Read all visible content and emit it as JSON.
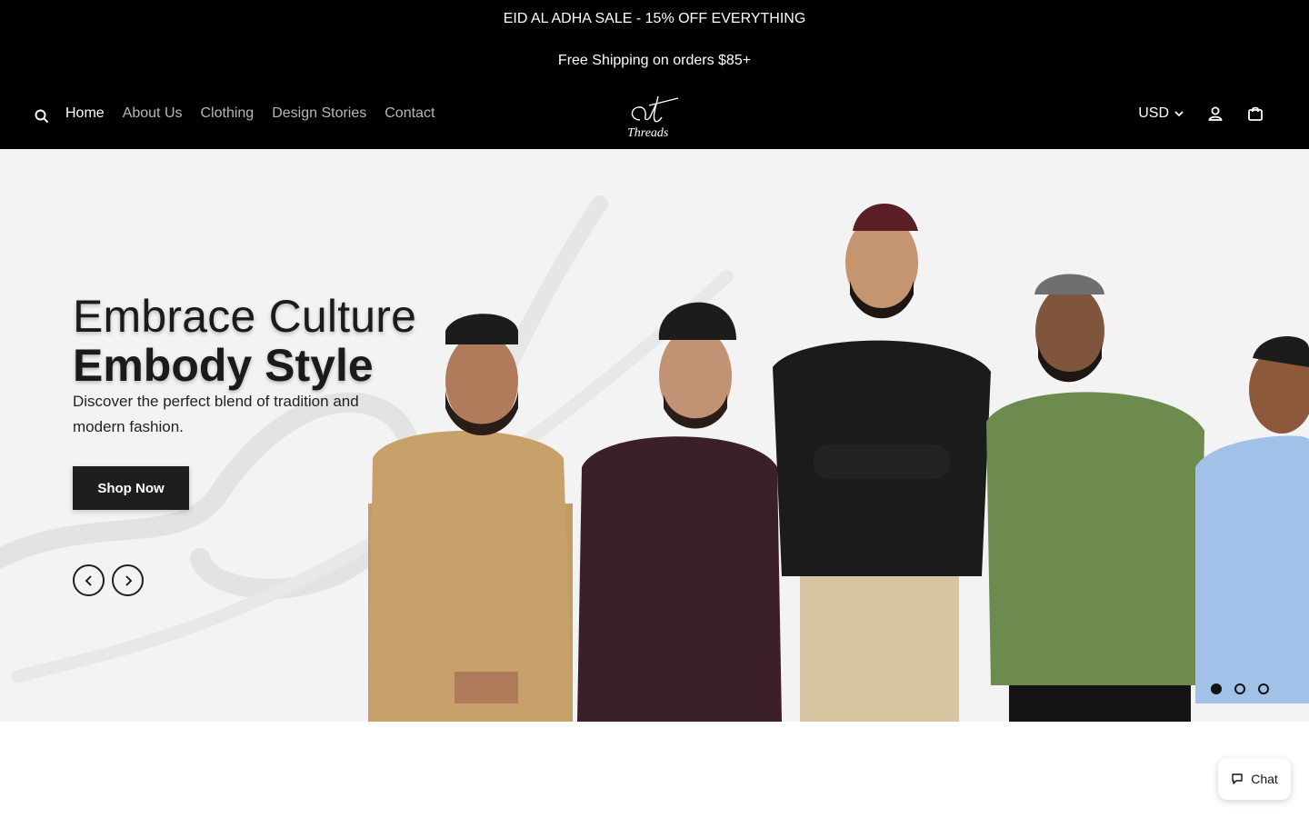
{
  "announcement": {
    "line1": "EID AL ADHA SALE - 15% OFF EVERYTHING",
    "line2": "Free Shipping on orders $85+"
  },
  "nav": {
    "items": [
      {
        "label": "Home",
        "active": true
      },
      {
        "label": "About Us"
      },
      {
        "label": "Clothing"
      },
      {
        "label": "Design Stories"
      },
      {
        "label": "Contact"
      }
    ]
  },
  "logo": {
    "mark": "at",
    "word": "Threads"
  },
  "header": {
    "currency": "USD"
  },
  "hero": {
    "title_line1": "Embrace Culture",
    "title_line2": "Embody Style",
    "subtitle": "Discover the perfect blend of tradition and modern fashion.",
    "cta": "Shop Now",
    "slides_total": 3,
    "current_slide": 1
  },
  "chat": {
    "label": "Chat"
  },
  "icons": {
    "search": "search-icon",
    "account": "user-icon",
    "cart": "shopping-bag-icon",
    "prev": "chevron-left-icon",
    "next": "chevron-right-icon",
    "chat": "chat-bubble-icon",
    "currency": "chevron-down-icon"
  },
  "colors": {
    "topbar": "#000000",
    "hero_bg": "#f3f3f3",
    "button_dark": "#1e1e1e",
    "model_colors": [
      "#c29a63",
      "#3a1f26",
      "#1a1a1a",
      "#6b8a4e",
      "#9dbde6"
    ]
  }
}
